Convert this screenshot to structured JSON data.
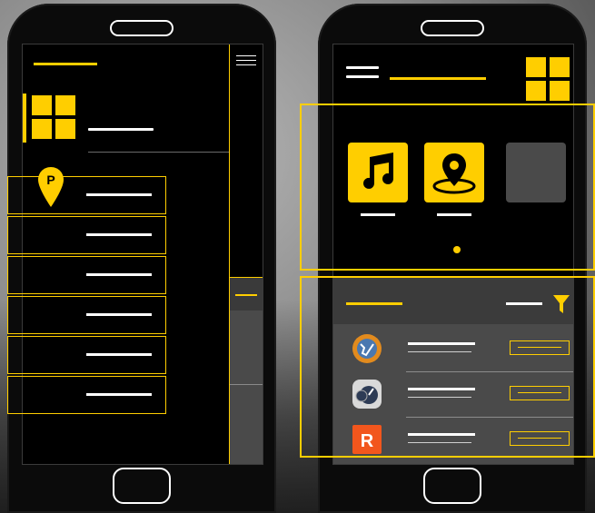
{
  "colors": {
    "accent": "#ffce00",
    "screen": "#000000",
    "gray_panel": "#4a4a4a",
    "line": "#ffffff"
  },
  "left_phone": {
    "icons": [
      "grid-icon",
      "hamburger-icon",
      "parking-pin-icon"
    ],
    "list_rows": 6,
    "parking_letter": "P"
  },
  "right_phone": {
    "app_icons": [
      "music-note-icon",
      "location-pin-icon",
      "blank-app-tile"
    ],
    "list_app_icons": [
      "world-globe-app-icon",
      "speedometer-app-icon",
      "r-app-icon"
    ],
    "r_app_letter": "R",
    "icons": [
      "hamburger-icon",
      "grid-icon",
      "filter-icon"
    ]
  }
}
